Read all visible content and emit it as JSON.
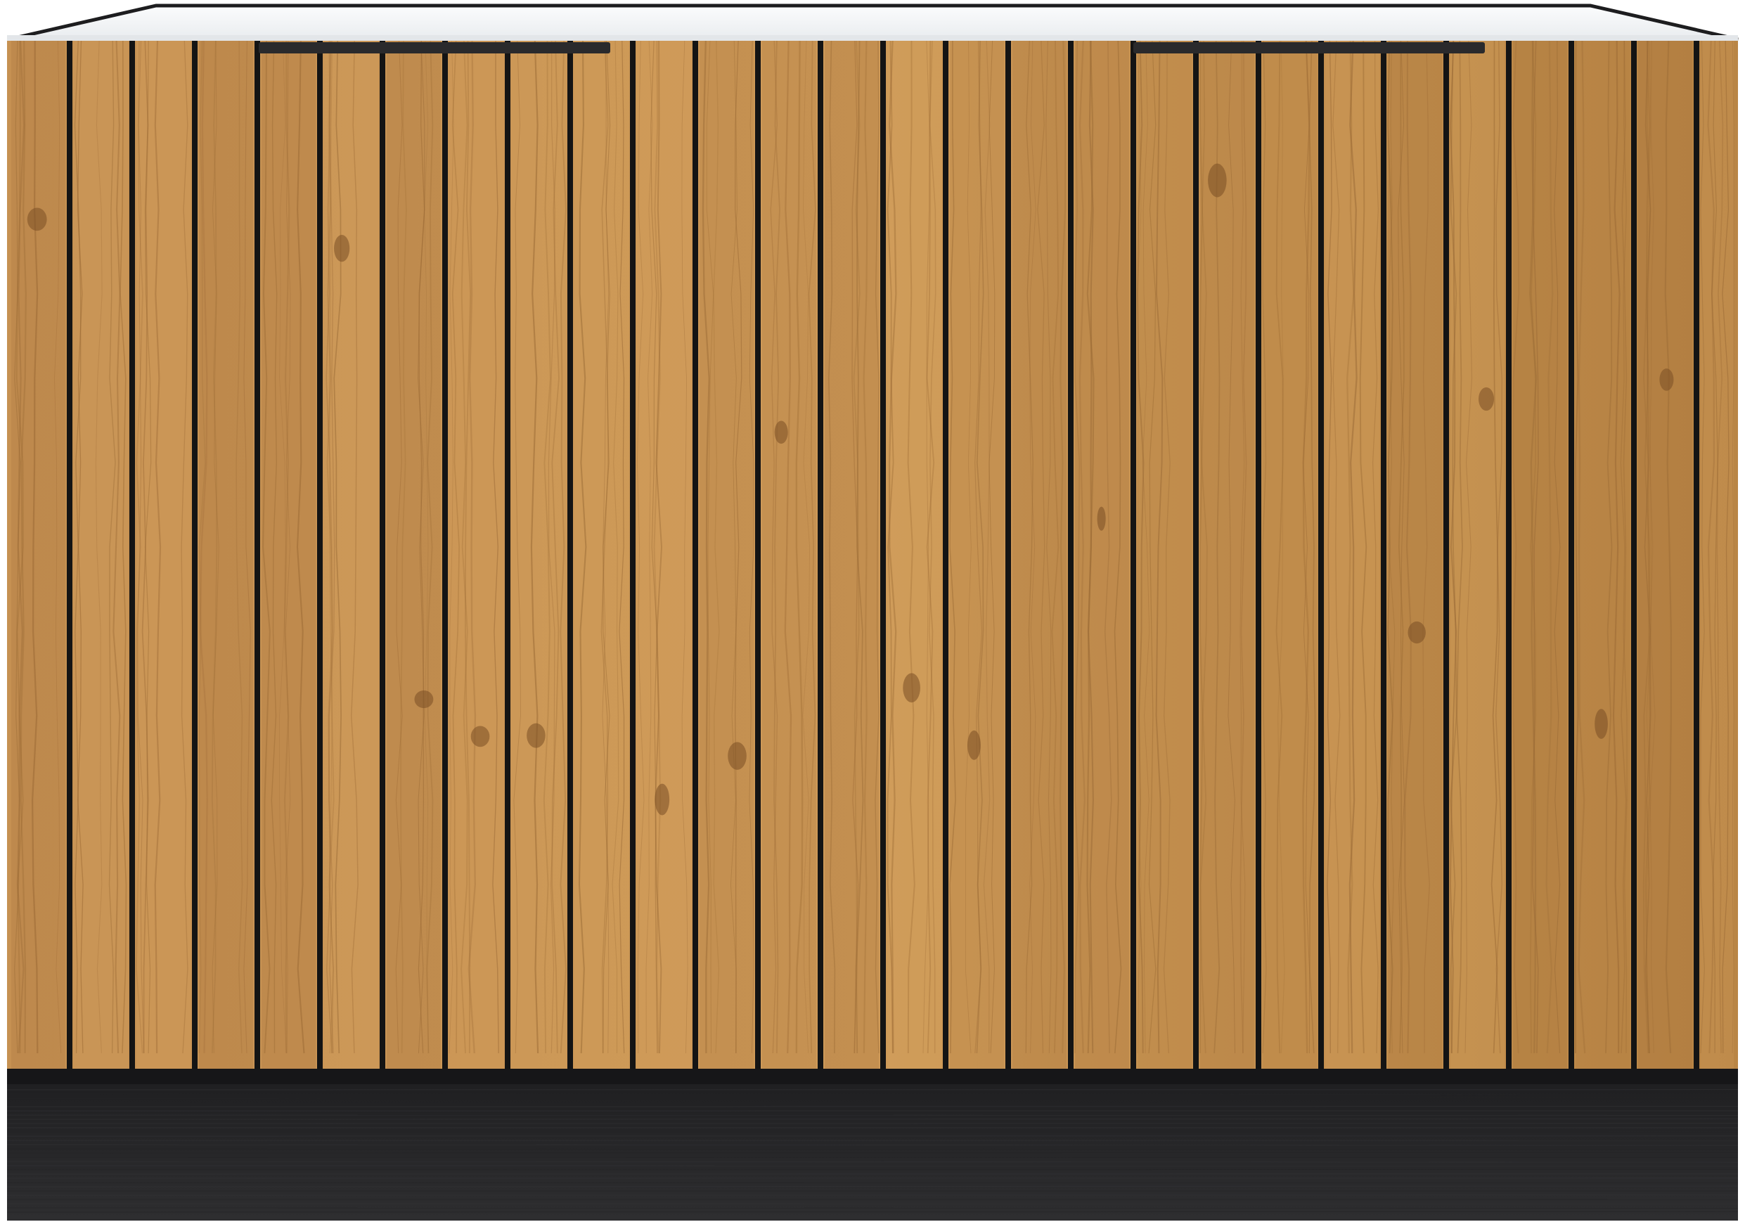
{
  "image": {
    "subject": "kitchen-base-cabinet",
    "view": "front",
    "door_count": 2,
    "handle_count": 2
  },
  "colors": {
    "background": "#ffffff",
    "countertop_top": "#f2f4f6",
    "countertop_edge": "#1d1d1f",
    "oak_base": "#c08a4a",
    "oak_light": "#d7a763",
    "oak_dark": "#9a6a35",
    "batten_gap": "#141414",
    "handle": "#2a2a2c",
    "plinth": "#2b2b2d",
    "plinth_dark": "#1f1f21"
  }
}
